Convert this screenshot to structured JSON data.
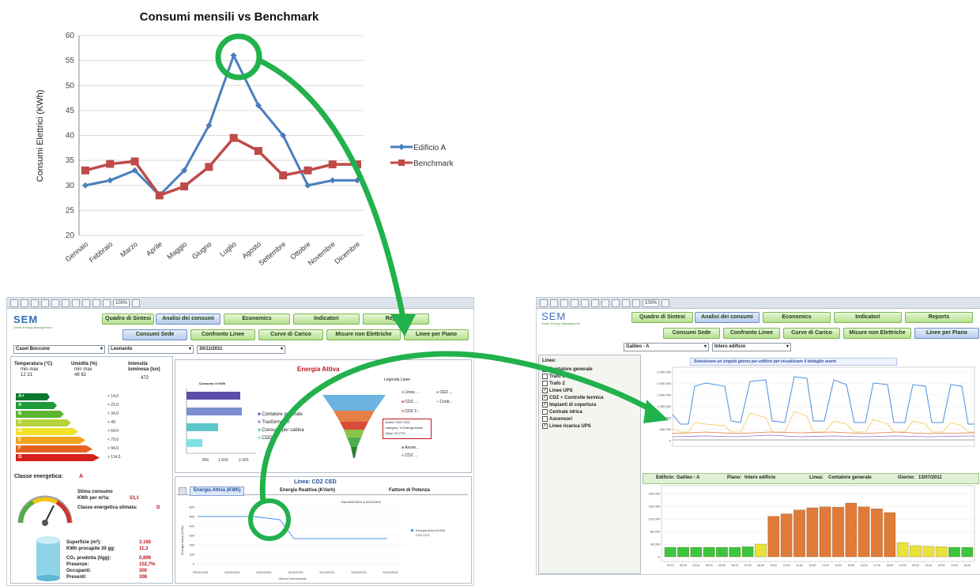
{
  "top_chart": {
    "title": "Consumi mensili vs Benchmark",
    "ylabel": "Consumi Elettrici (KWh)",
    "yticks": [
      "60",
      "55",
      "50",
      "45",
      "40",
      "35",
      "30",
      "25",
      "20"
    ],
    "months": [
      "Gennaio",
      "Febbraio",
      "Marzo",
      "Aprile",
      "Maggio",
      "Giugno",
      "Luglio",
      "Agosto",
      "Settembre",
      "Ottobre",
      "Novembre",
      "Dicembre"
    ],
    "legend_a": "Edificio A",
    "legend_b": "Benchmark"
  },
  "chart_data": [
    {
      "type": "line",
      "title": "Consumi mensili vs Benchmark",
      "xlabel": "",
      "ylabel": "Consumi Elettrici (KWh)",
      "ylim": [
        20,
        60
      ],
      "categories": [
        "Gennaio",
        "Febbraio",
        "Marzo",
        "Aprile",
        "Maggio",
        "Giugno",
        "Luglio",
        "Agosto",
        "Settembre",
        "Ottobre",
        "Novembre",
        "Dicembre"
      ],
      "series": [
        {
          "name": "Edificio A",
          "color": "#4a7ebb",
          "values": [
            30,
            31,
            33,
            28,
            33,
            42,
            56,
            46,
            40,
            30,
            31,
            31
          ]
        },
        {
          "name": "Benchmark",
          "color": "#be4b48",
          "values": [
            33,
            34.3,
            34.8,
            28,
            29.8,
            33.7,
            39.5,
            36.9,
            32,
            33,
            34.2,
            34.2
          ]
        }
      ],
      "legend": "right",
      "grid": true
    }
  ],
  "left_app": {
    "logo": "SEM",
    "logo_sub": "Smart Energy Management",
    "zoom": "100%",
    "nav_row1": [
      "Quadro di Sintesi",
      "Analisi dei consumi",
      "Economics",
      "Indicatori",
      "Reports"
    ],
    "nav_row2": [
      "Consumi Sede",
      "Confronto Linee",
      "Curve di Carico",
      "Misure non Elettriche",
      "Linee per Piano"
    ],
    "selects": [
      "Casel Boccone",
      "Leonardo",
      "30/11/2011"
    ],
    "temp_label": "Temperatura (°C)",
    "temp_sub": "min  max",
    "temp_vals": "12  21",
    "hum_label": "Umidità (%)",
    "hum_sub": "min  max",
    "hum_vals": "48  82",
    "lux_label": "Intensità luminosa (lux)",
    "lux_val": "472",
    "energy_classes": [
      "A+",
      "A",
      "B",
      "C",
      "D",
      "E",
      "F",
      "G"
    ],
    "energy_values": [
      "< 14,0",
      "< 22,0",
      "< 34,0",
      "< 49",
      "< 64,0",
      "< 79,0",
      "> 94,0",
      "> 114,0"
    ],
    "classe_label": "Classe energetica:",
    "classe_val": "A",
    "stima_label": "Stima consumo",
    "kwh_m2_label": "KWh per m²/a:",
    "kwh_m2_val": "53,1",
    "classe_stimata_label": "Classe energetica stimata:",
    "classe_stimata_val": "D",
    "superficie_label": "Superficie (m²):",
    "superficie_val": "3.160",
    "kwh30_label": "KWh procapite 30 gg:",
    "kwh30_val": "11,3",
    "co2_label": "CO₂ prodotta (t/gg):",
    "co2_val": "0,899",
    "presenze_label": "Presenze:",
    "presenze_val": "102,7%",
    "occupanti_label": "Occupanti:",
    "occupanti_val": "300",
    "presenti_label": "Presenti:",
    "presenti_val": "308",
    "energia_attiva_title": "Energia Attiva",
    "consumo_kwh_title": "Consumo in KWh",
    "bar_legend": [
      "Contatore generale",
      "Trasformatori",
      "Consumi per cabina",
      "CDD"
    ],
    "bar_ticks": [
      "800",
      "1.600",
      "2.400"
    ],
    "funnel_legend_title": "Legenda Linee",
    "funnel_legend": [
      "Linea ...",
      "CED ...",
      "CDZ ...",
      "Contr...",
      "CDZ 2...",
      "Ascen...",
      "CDZ ..."
    ],
    "tooltip_lines": [
      "Series: CDZ CED",
      "Category: % Energia Attiva",
      "Value: 20,77%"
    ],
    "linea_title": "Linea: CDZ CED",
    "tab_active": "Energia Attiva (KWh)",
    "tab_2": "Energia Reattiva (KVarh)",
    "tab_3": "Fattore di Potenza",
    "period": "Dal 05/11/2011 a 20/11/2011",
    "line_ylabel": "Energia Attiva (KWh)",
    "line_yticks": [
      "600",
      "500",
      "400",
      "300",
      "200",
      "100",
      "0"
    ],
    "line_xticks": [
      "05/11/2011",
      "04/11/2011",
      "03/11/2011",
      "01/11/2011",
      "31/10/2011",
      "30/10/2011",
      "29/10/2011"
    ],
    "line_xlabel": "Giorno Decrescente",
    "line_legend": [
      "Energia Attiva (KWh)",
      "CDZ CED"
    ]
  },
  "right_app": {
    "logo": "SEM",
    "logo_sub": "Smart Energy Management",
    "zoom": "100%",
    "nav_row1": [
      "Quadro di Sintesi",
      "Analisi dei consumi",
      "Economics",
      "Indicatori",
      "Reports"
    ],
    "nav_row2": [
      "Consumi Sede",
      "Confronto Linee",
      "Curve di Carico",
      "Misure non Elettriche",
      "Linee per Piano"
    ],
    "selects": [
      "Galileo - A",
      "Intero edificio"
    ],
    "linee_title": "Linee:",
    "linee": [
      "Contatore generale",
      "Trafo 1",
      "Trafo 2",
      "Linee UPS",
      "CDZ + Controlle termica",
      "Impianti di copertura",
      "Centrale idrica",
      "Ascensori",
      "Linee ricarica UPS"
    ],
    "linee_checked": [
      false,
      false,
      false,
      true,
      true,
      true,
      false,
      false,
      true
    ],
    "instruction": "Selezionare un singolo giorno per edificio per visualizzare il dettaglio orario",
    "yticks_top": [
      "2.400.000",
      "2.000.000",
      "1.600.000",
      "1.200.000",
      "800.000",
      "400.000",
      "0"
    ],
    "info_edificio_label": "Edificio:",
    "info_edificio_val": "Galileo - A",
    "info_piano_label": "Piano:",
    "info_piano_val": "Intero edificio",
    "info_linea_label": "Linea:",
    "info_linea_val": "Contatore generale",
    "info_giorno_label": "Giorno:",
    "info_giorno_val": "13/07/2011",
    "yticks_bottom": [
      "200.000",
      "160.000",
      "120.000",
      "80.000",
      "40.000",
      "0"
    ],
    "hour_labels": [
      "01:00",
      "02:00",
      "03:00",
      "04:00",
      "05:00",
      "06:00",
      "07:00",
      "08:00",
      "09:00",
      "10:00",
      "11:00",
      "12:00",
      "13:00",
      "14:00",
      "15:00",
      "16:00",
      "17:00",
      "18:00",
      "19:00",
      "20:00",
      "21:00",
      "22:00",
      "23:00",
      "24:00"
    ],
    "hour_values": [
      30,
      30,
      30,
      30,
      30,
      30,
      32,
      40,
      128,
      136,
      148,
      155,
      158,
      157,
      170,
      158,
      152,
      140,
      45,
      35,
      33,
      32,
      30,
      30
    ]
  }
}
